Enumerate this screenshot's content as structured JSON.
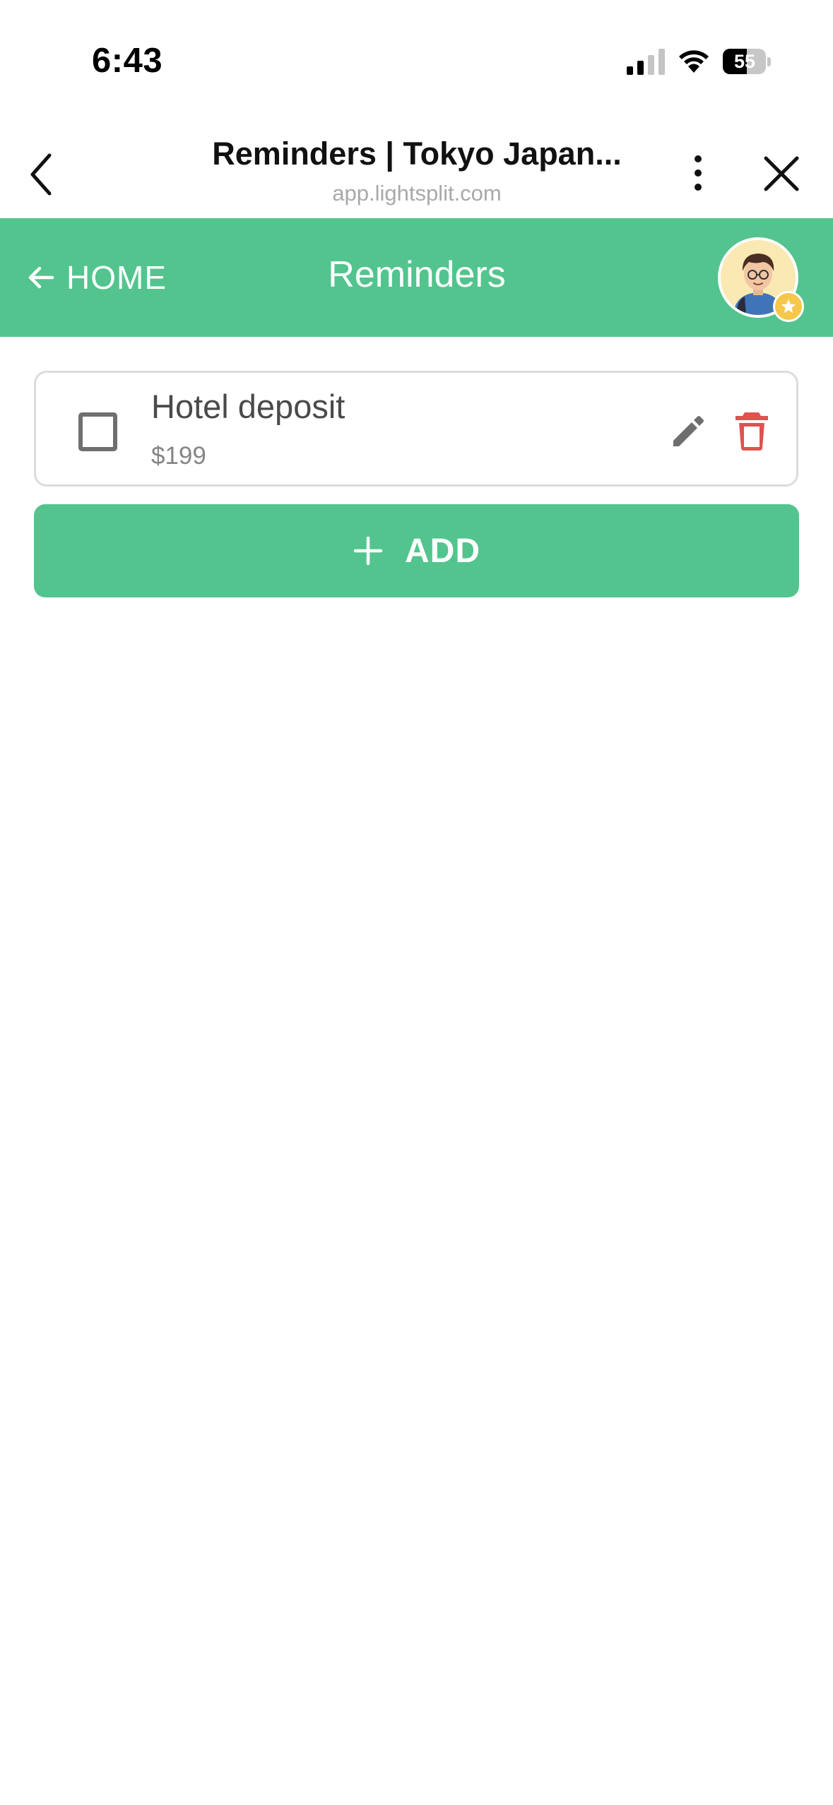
{
  "status_bar": {
    "time": "6:43",
    "battery_level": "55",
    "icons": [
      "signal-icon",
      "wifi-icon",
      "battery-icon"
    ]
  },
  "browser": {
    "title": "Reminders | Tokyo Japan...",
    "url": "app.lightsplit.com",
    "icons": [
      "back-chevron-icon",
      "more-vertical-icon",
      "close-icon"
    ]
  },
  "header": {
    "home_label": "HOME",
    "title": "Reminders",
    "accent_color": "#53c48e"
  },
  "reminders": [
    {
      "title": "Hotel deposit",
      "amount": "$199",
      "checked": false
    }
  ],
  "actions": {
    "add_label": "ADD",
    "delete_color": "#e0514f"
  }
}
